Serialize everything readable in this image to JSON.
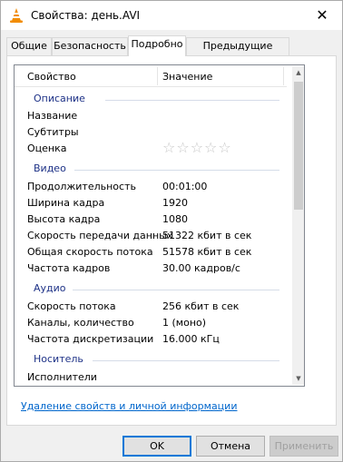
{
  "window": {
    "title": "Свойства: день.AVI",
    "close_glyph": "✕"
  },
  "tabs": [
    {
      "label": "Общие",
      "active": false
    },
    {
      "label": "Безопасность",
      "active": false
    },
    {
      "label": "Подробно",
      "active": true
    },
    {
      "label": "Предыдущие версии",
      "active": false
    }
  ],
  "list": {
    "header": {
      "property": "Свойство",
      "value": "Значение"
    },
    "groups": {
      "description": "Описание",
      "video": "Видео",
      "audio": "Аудио",
      "media": "Носитель"
    },
    "rows": {
      "title": {
        "k": "Название",
        "v": ""
      },
      "subtitles": {
        "k": "Субтитры",
        "v": ""
      },
      "rating": {
        "k": "Оценка",
        "stars": 5,
        "filled": 0
      },
      "duration": {
        "k": "Продолжительность",
        "v": "00:01:00"
      },
      "width": {
        "k": "Ширина кадра",
        "v": "1920"
      },
      "height": {
        "k": "Высота кадра",
        "v": "1080"
      },
      "bitrate": {
        "k": "Скорость передачи данных",
        "v": "51322 кбит в сек"
      },
      "total_bitrate": {
        "k": "Общая скорость потока",
        "v": "51578 кбит в сек"
      },
      "framerate": {
        "k": "Частота кадров",
        "v": "30.00 кадров/с"
      },
      "audio_bitrate": {
        "k": "Скорость потока",
        "v": "256 кбит в сек"
      },
      "channels": {
        "k": "Каналы, количество",
        "v": "1 (моно)"
      },
      "sample_rate": {
        "k": "Частота дискретизации",
        "v": "16.000 кГц"
      },
      "performers": {
        "k": "Исполнители",
        "v": ""
      }
    }
  },
  "remove_link": "Удаление свойств и личной информации",
  "buttons": {
    "ok": "OK",
    "cancel": "Отмена",
    "apply": "Применить"
  }
}
